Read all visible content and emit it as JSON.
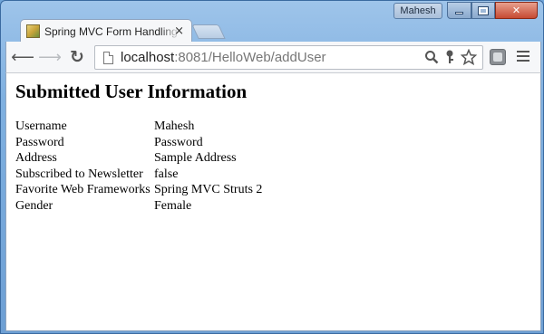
{
  "window": {
    "user_badge": "Mahesh"
  },
  "tab": {
    "title": "Spring MVC Form Handling",
    "close_glyph": "×"
  },
  "toolbar": {
    "url_host": "localhost",
    "url_rest": ":8081/HelloWeb/addUser"
  },
  "page": {
    "heading": "Submitted User Information",
    "rows": [
      {
        "label": "Username",
        "value": "Mahesh"
      },
      {
        "label": "Password",
        "value": "Password"
      },
      {
        "label": "Address",
        "value": "Sample Address"
      },
      {
        "label": "Subscribed to Newsletter",
        "value": "false"
      },
      {
        "label": "Favorite Web Frameworks",
        "value": "Spring MVC Struts 2"
      },
      {
        "label": "Gender",
        "value": "Female"
      }
    ]
  },
  "colors": {
    "frame": "#7fb0e0",
    "close_button": "#c64b33",
    "page_bg": "#ffffff"
  },
  "icons": {
    "back": "back-arrow-icon",
    "forward": "forward-arrow-icon",
    "reload": "reload-icon",
    "page": "page-icon",
    "search": "magnifier-icon",
    "key": "key-icon",
    "bookmark": "star-icon",
    "extension": "extension-icon",
    "menu": "hamburger-menu-icon"
  }
}
